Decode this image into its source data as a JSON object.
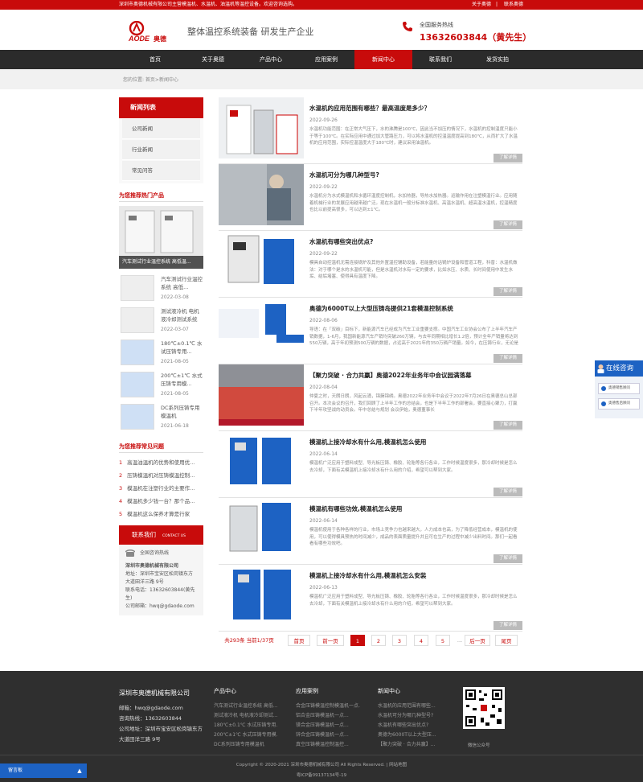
{
  "topbar": {
    "intro": "深圳市奥德机械有限公司主营模温机、水温机、油温机等温控设备。欢迎咨询选购。",
    "about": "关于奥德",
    "contact": "联系奥德"
  },
  "header": {
    "logo_text": "AODE奥德",
    "slogan": "整体温控系统装备 研发生产企业",
    "hotline_label": "全国服务热线",
    "hotline_number": "13632603844（黄先生）"
  },
  "nav": [
    "首页",
    "关于奥德",
    "产品中心",
    "应用案例",
    "新闻中心",
    "联系我们",
    "发货实拍"
  ],
  "breadcrumb": "您的位置: 首页>新闻中心",
  "sidebar": {
    "category_title": "新闻列表",
    "categories": [
      "公司新闻",
      "行业新闻",
      "常见问答"
    ],
    "hot_title": "为您推荐热门产品",
    "big_product_caption": "汽车测试行业温控系统 高低温...",
    "products": [
      {
        "name": "汽车测试行业温控系统 高低...",
        "date": "2022-03-08"
      },
      {
        "name": "测试液冷机 电机液冷却测试系统",
        "date": "2022-03-07"
      },
      {
        "name": "180℃±0.1℃ 水试压铸专用...",
        "date": "2021-08-05"
      },
      {
        "name": "200℃±1℃ 水式压铸专用模...",
        "date": "2021-08-05"
      },
      {
        "name": "DC系列压铸专用模温机",
        "date": "2021-06-18"
      }
    ],
    "faq_title": "为您推荐常见问题",
    "faqs": [
      "高温油温机的优势和使用优...",
      "压铸模温机对压铸模温控制...",
      "模温机在注塑行业的主要作...",
      "模温机多少钱一台？那个品...",
      "模温机这么保养才算是行家"
    ],
    "contact_title": "联系我们",
    "contact_en": "CONTACT US",
    "contact_hotline": "全国咨询热线",
    "contact_company": "深圳市奥德机械有限公司",
    "contact_address": "地址：深圳市宝安区松岗镇东方大道田洋三路 9号",
    "contact_phone": "联系电话：13632603844(黄先生)",
    "contact_email": "公司邮箱：hwq@gdaode.com"
  },
  "articles": [
    {
      "title": "水温机的应用范围有哪些？最高温度是多少？",
      "date": "2022-09-26",
      "summary": "水温机功能范围：在正常大气压下，水的沸腾是100℃，因此当不加压的情况下，水温机的控制温度只能小于等于100℃。在实际应用中通过加大管路压力，可以将水温机的控温温度提高到180℃，从而扩大了水温机的应用范围，实际控温温度大于180℃时，建议采用油温机。",
      "more": "了解详情"
    },
    {
      "title": "水温机可分为哪几种型号?",
      "date": "2022-09-22",
      "summary": "水温机分为水式模温机和水循环温度控制机，水加热器，导热水加热器。运输作用在注塑模温行业。应用随着机械行业的发展应用越来越广泛。现在水温机一般分标准水温机、高温水温机、超高温水温机，控温精度也比以前提高很多，可以达到±1℃。",
      "more": "了解详情"
    },
    {
      "title": "水温机有哪些突出优点?",
      "date": "2022-09-22",
      "summary": "模具自动控温机无需连接锅炉及其他外置温控辅助设备，若能量的话锅炉设备和管道工程，科普：水温机做法：对于哪个是水的水温机可能，但是水温机对水有一定的要求，比如水压、水质、长时间使用中发生水垢、结垢堵塞、使得具有温度下降。",
      "more": "了解详情"
    },
    {
      "title": "奥德为6000T以上大型压铸岛提供21套模温控制系统",
      "date": "2022-08-06",
      "summary": "导语：在「双碳」目标下，新能源汽车已经成为汽车工业重要支撑。中国汽车工业协会公布了上半年汽车产销数据，1-6月，我国新能源汽车产销均突破260万辆，与去年同期相比增长1.2倍，预计全年产销量将达到550万辆，高于年初预测500万辆的数据，占远高于2021年的350万辆产销量。如今，在压铸行业，无论是上游压铸设备，还是加工",
      "more": "了解详情"
    },
    {
      "title": "【聚力突破 · 合力共赢】奥德2022年业务年中会议园满落幕",
      "date": "2022-08-04",
      "summary": "仲夏之时，天朗日朗，风起云涌，锦簇锦绣。奥德2022年业务年中会议于2022年7月26日在奥德总山总部召开。本次会议的召开，我们回顾了上半年工作的总结会，也是下半年工作的部署会，要直接心聚力，打赢下半年攻坚战的动员会。年中总结与规划 会议伊始，奥德董事长",
      "more": "了解详情"
    },
    {
      "title": "模温机上接冷却水有什么用,模温机怎么使用",
      "date": "2022-06-14",
      "summary": "模温机广泛应用于塑料成型、导光板压铸、橡胶、轮胎等各行各业，工作时候温度很多，那冷却时候是怎么去冷却，下面有关模温机上接冷却水有什么用的介绍，希望可以帮到大家。",
      "more": "了解详情"
    },
    {
      "title": "模温机有哪些功效,模温机怎么使用",
      "date": "2022-06-14",
      "summary": "模温机使用于各种各样的行业，市场上竞争力也越来越大，人力成本也高，为了降低经营成本，模温机的使用，可以使得模具预热的时间减少，成品的表面质量提升并且可在生产的过程中减少出料时间。那们一起看看有哪些功效吧。",
      "more": "了解详情"
    },
    {
      "title": "模温机上接冷却水有什么用,模温机怎么安装",
      "date": "2022-06-13",
      "summary": "模温机广泛应用于塑料成型、导光板压铸、橡胶、轮胎等各行各业，工作时候温度很多，那冷却时候是怎么去冷却，下面有关模温机上接冷却水有什么用的介绍，希望可以帮到大家。",
      "more": "了解详情"
    }
  ],
  "pager": {
    "summary": "共293条 当前1/37页",
    "first": "首页",
    "prev": "前一页",
    "pages": [
      "1",
      "2",
      "3",
      "4",
      "5"
    ],
    "ellipsis": "...",
    "next": "后一页",
    "last": "尾页"
  },
  "float": {
    "title": "在线咨询",
    "btn1": "奥德销售顾问",
    "btn2": "奥德售后顾问"
  },
  "footer": {
    "company": "深圳市奥德机械有限公司",
    "email": "邮箱：hwq@gdaode.com",
    "phone": "咨询热线：13632603844",
    "address": "公司地址：深圳市宝安区松岗镇东方大道田洋三路 9号",
    "cols": [
      {
        "title": "产品中心",
        "items": [
          "汽车测试行业温控系统 高低...",
          "测试液冷机 电机液冷却测试...",
          "180℃±0.1℃ 水试压铸专用...",
          "200℃±1℃ 水式压铸专用模...",
          "DC系列压铸专用模温机"
        ]
      },
      {
        "title": "应用案例",
        "items": [
          "合金压铸模温控制模温机一点...",
          "铝合金压铸模温机一点...",
          "镁合金压铸模温机一点...",
          "锌合金压铸模温机一点...",
          "真空压铸模温控制温控..."
        ]
      },
      {
        "title": "新闻中心",
        "items": [
          "水温机的应用范围有哪些...",
          "水温机可分为哪几种型号?",
          "水温机有哪些突出优点?",
          "奥德为6000T以上大型压...",
          "【聚力突破 · 合力共赢】..."
        ]
      }
    ],
    "qr_label": "微信公众号",
    "copyright": "Copyright © 2020-2021 深圳市奥德机械有限公司 All Rights Reserved. | 网站地图",
    "icp": "粤ICP备09137134号-19",
    "message": "留言板"
  },
  "colors": {
    "brand": "#c80b0b",
    "nav": "#2b2b2b",
    "footer": "#2f2f2f",
    "chat": "#1d62c3"
  }
}
